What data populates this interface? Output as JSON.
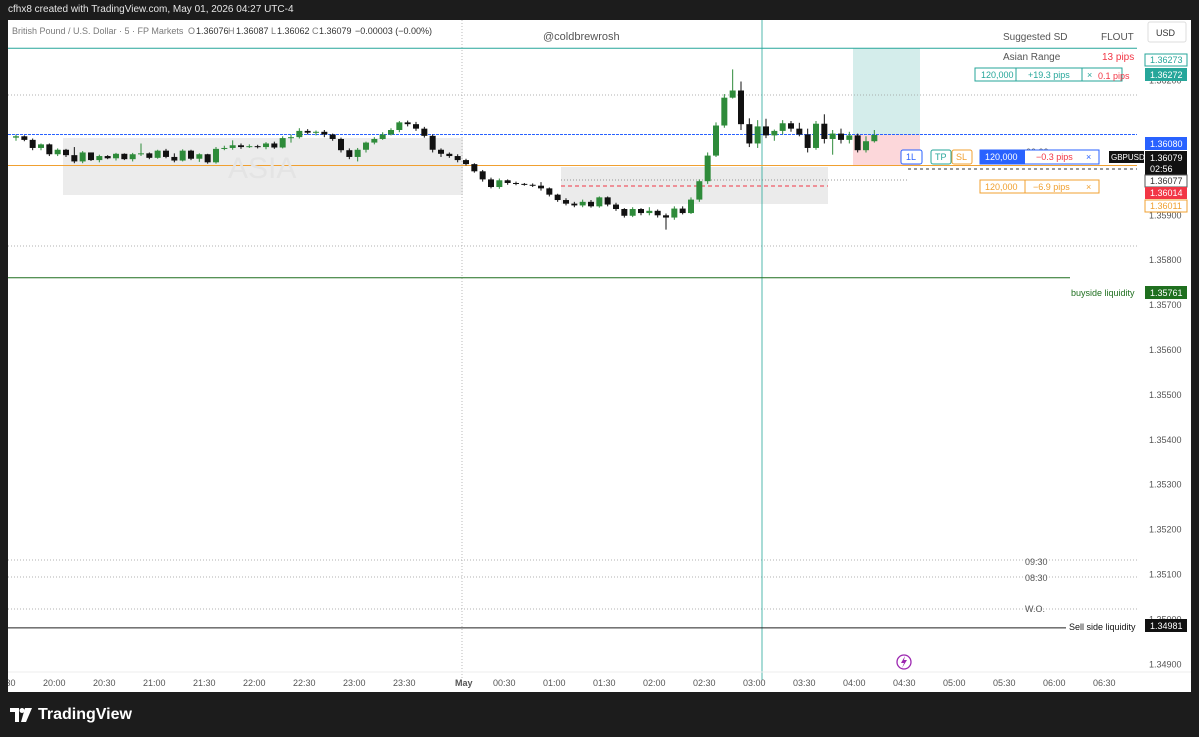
{
  "header": {
    "text": "cfhx8 created with TradingView.com, May 01, 2026 04:27 UTC-4"
  },
  "legend": {
    "symbol": "British Pound / U.S. Dollar · 5 · FP Markets",
    "o_label": "O",
    "o": "1.36076",
    "h_label": "H",
    "h": "1.36087",
    "l_label": "L",
    "l": "1.36062",
    "c_label": "C",
    "c": "1.36079",
    "change": "−0.00003 (−0.00%)"
  },
  "watermark": "@coldbrewrosh",
  "info_table": {
    "row1_label": "Suggested SD",
    "row1_value": "FLOUT",
    "row2_label": "Asian Range",
    "row2_value": "13 pips"
  },
  "currency": "USD",
  "asia_label": "ASIA",
  "symbol_tag": "GBPUSD",
  "countdown": "02:56",
  "colors": {
    "bull": "#2e8b3a",
    "bear": "#111111",
    "teal": "#26a69a",
    "blue": "#2962ff",
    "orange": "#f0a030",
    "red": "#f23645",
    "dark_green": "#1f6f1f"
  },
  "orders": {
    "tp": {
      "qty": "120,000",
      "pips": "+19.3 pips",
      "close": "×",
      "right_text": "0.1 pips"
    },
    "entry": {
      "qty": "120,000",
      "pips": "−0.3 pips",
      "close": "×"
    },
    "sl": {
      "qty": "120,000",
      "pips": "−6.9 pips",
      "close": "×"
    },
    "btn_direction": "1L",
    "btn_tp": "TP",
    "btn_sl": "SL"
  },
  "levels": {
    "buyside": "buyside liquidity",
    "sellside": "Sell side liquidity",
    "t0930": "09:30",
    "t0830": "08:30",
    "t0000": "00:00",
    "wo": "W.O."
  },
  "price_tags": {
    "p1": "1.36273",
    "p2": "1.36272",
    "p3": "1.36080",
    "p4": "1.36079",
    "p5": "1.36077",
    "p6": "1.36014",
    "p7": "1.36011",
    "p8": "1.35761",
    "p9": "1.34981"
  },
  "brand": "TradingView",
  "chart_data": {
    "type": "candlestick",
    "y_ticks": [
      "1.36200",
      "1.35900",
      "1.35800",
      "1.35700",
      "1.35600",
      "1.35500",
      "1.35400",
      "1.35300",
      "1.35200",
      "1.35100",
      "1.35000",
      "1.34900"
    ],
    "y_tick_values": [
      1.362,
      1.359,
      1.358,
      1.357,
      1.356,
      1.355,
      1.354,
      1.353,
      1.352,
      1.351,
      1.35,
      1.349
    ],
    "x_ticks": [
      "19:30",
      "20:00",
      "20:30",
      "21:00",
      "21:30",
      "22:00",
      "22:30",
      "23:00",
      "23:30",
      "May",
      "00:30",
      "01:00",
      "01:30",
      "02:00",
      "02:30",
      "03:00",
      "03:30",
      "04:00",
      "04:30",
      "05:00",
      "05:30",
      "06:00",
      "06:30"
    ],
    "ylim": [
      1.34865,
      1.36335
    ],
    "levels": {
      "tp": 1.36272,
      "entry": 1.3608,
      "sl": 1.36011,
      "buyside": 1.35761,
      "sellside": 1.34981
    },
    "candles": [
      [
        1.36073,
        1.3608,
        1.36066,
        1.36076
      ],
      [
        1.36076,
        1.36078,
        1.36065,
        1.36068
      ],
      [
        1.36068,
        1.36071,
        1.36045,
        1.3605
      ],
      [
        1.3605,
        1.3606,
        1.36045,
        1.36058
      ],
      [
        1.36058,
        1.3606,
        1.36032,
        1.36036
      ],
      [
        1.36036,
        1.36049,
        1.36032,
        1.36046
      ],
      [
        1.36046,
        1.36048,
        1.3603,
        1.36034
      ],
      [
        1.36034,
        1.36052,
        1.36016,
        1.3602
      ],
      [
        1.3602,
        1.36043,
        1.36016,
        1.3604
      ],
      [
        1.3604,
        1.3604,
        1.36021,
        1.36023
      ],
      [
        1.36023,
        1.36035,
        1.36018,
        1.36032
      ],
      [
        1.36032,
        1.36034,
        1.36025,
        1.36027
      ],
      [
        1.36027,
        1.36039,
        1.36022,
        1.36037
      ],
      [
        1.36037,
        1.36038,
        1.36023,
        1.36025
      ],
      [
        1.36025,
        1.36039,
        1.3602,
        1.36036
      ],
      [
        1.36036,
        1.3606,
        1.36032,
        1.36038
      ],
      [
        1.36038,
        1.3604,
        1.36025,
        1.36028
      ],
      [
        1.36028,
        1.36046,
        1.36026,
        1.36044
      ],
      [
        1.36044,
        1.36048,
        1.36027,
        1.3603
      ],
      [
        1.3603,
        1.36038,
        1.36018,
        1.36022
      ],
      [
        1.36022,
        1.36047,
        1.3602,
        1.36044
      ],
      [
        1.36044,
        1.36046,
        1.36023,
        1.36026
      ],
      [
        1.36026,
        1.36038,
        1.36019,
        1.36036
      ],
      [
        1.36036,
        1.36037,
        1.36015,
        1.36018
      ],
      [
        1.36018,
        1.36052,
        1.36015,
        1.36048
      ],
      [
        1.36048,
        1.36055,
        1.36045,
        1.3605
      ],
      [
        1.3605,
        1.36067,
        1.36046,
        1.36056
      ],
      [
        1.36056,
        1.3606,
        1.36048,
        1.36052
      ],
      [
        1.36052,
        1.36058,
        1.3605,
        1.36054
      ],
      [
        1.36054,
        1.36057,
        1.36049,
        1.36052
      ],
      [
        1.36052,
        1.36063,
        1.36047,
        1.3606
      ],
      [
        1.3606,
        1.36064,
        1.36048,
        1.36051
      ],
      [
        1.36051,
        1.36076,
        1.36049,
        1.36072
      ],
      [
        1.36072,
        1.3608,
        1.36062,
        1.36074
      ],
      [
        1.36074,
        1.36094,
        1.36071,
        1.36088
      ],
      [
        1.36088,
        1.36092,
        1.3608,
        1.36084
      ],
      [
        1.36084,
        1.36089,
        1.36078,
        1.36086
      ],
      [
        1.36086,
        1.3609,
        1.36074,
        1.3608
      ],
      [
        1.3608,
        1.36082,
        1.36066,
        1.3607
      ],
      [
        1.3607,
        1.36073,
        1.3604,
        1.36045
      ],
      [
        1.36045,
        1.36049,
        1.36025,
        1.3603
      ],
      [
        1.3603,
        1.3605,
        1.3602,
        1.36046
      ],
      [
        1.36046,
        1.36064,
        1.3604,
        1.36062
      ],
      [
        1.36062,
        1.36074,
        1.36058,
        1.3607
      ],
      [
        1.3607,
        1.36085,
        1.36068,
        1.3608
      ],
      [
        1.3608,
        1.36094,
        1.36078,
        1.3609
      ],
      [
        1.3609,
        1.3611,
        1.36085,
        1.36107
      ],
      [
        1.36107,
        1.36111,
        1.36098,
        1.36103
      ],
      [
        1.36103,
        1.36108,
        1.36088,
        1.36093
      ],
      [
        1.36093,
        1.36097,
        1.36073,
        1.36077
      ],
      [
        1.36077,
        1.3608,
        1.3604,
        1.36046
      ],
      [
        1.36046,
        1.36049,
        1.3603,
        1.36037
      ],
      [
        1.36037,
        1.3604,
        1.36028,
        1.36032
      ],
      [
        1.36032,
        1.36036,
        1.36018,
        1.36023
      ],
      [
        1.36023,
        1.36026,
        1.36011,
        1.36014
      ],
      [
        1.36014,
        1.36016,
        1.35995,
        1.35998
      ],
      [
        1.35998,
        1.36001,
        1.35975,
        1.3598
      ],
      [
        1.3598,
        1.35984,
        1.3596,
        1.35963
      ],
      [
        1.35963,
        1.35982,
        1.35959,
        1.35978
      ],
      [
        1.35978,
        1.3598,
        1.35968,
        1.35972
      ],
      [
        1.35972,
        1.35975,
        1.35967,
        1.3597
      ],
      [
        1.3597,
        1.35972,
        1.35966,
        1.35968
      ],
      [
        1.35968,
        1.35971,
        1.35963,
        1.35966
      ],
      [
        1.35966,
        1.35974,
        1.35955,
        1.3596
      ],
      [
        1.3596,
        1.35962,
        1.35942,
        1.35946
      ],
      [
        1.35946,
        1.35948,
        1.3593,
        1.35934
      ],
      [
        1.35934,
        1.35938,
        1.35922,
        1.35926
      ],
      [
        1.35926,
        1.3593,
        1.35918,
        1.35922
      ],
      [
        1.35922,
        1.35935,
        1.35918,
        1.3593
      ],
      [
        1.3593,
        1.35934,
        1.35917,
        1.3592
      ],
      [
        1.3592,
        1.35942,
        1.35917,
        1.3594
      ],
      [
        1.3594,
        1.35942,
        1.3592,
        1.35924
      ],
      [
        1.35924,
        1.35928,
        1.3591,
        1.35914
      ],
      [
        1.35914,
        1.35916,
        1.35895,
        1.35899
      ],
      [
        1.35899,
        1.35918,
        1.35896,
        1.35914
      ],
      [
        1.35914,
        1.35916,
        1.359,
        1.35905
      ],
      [
        1.35905,
        1.35918,
        1.359,
        1.3591
      ],
      [
        1.3591,
        1.35913,
        1.35895,
        1.359
      ],
      [
        1.359,
        1.35904,
        1.35868,
        1.35895
      ],
      [
        1.35895,
        1.3592,
        1.3589,
        1.35915
      ],
      [
        1.35915,
        1.3592,
        1.35902,
        1.35905
      ],
      [
        1.35905,
        1.3594,
        1.35903,
        1.35935
      ],
      [
        1.35935,
        1.3598,
        1.3593,
        1.35976
      ],
      [
        1.35976,
        1.3604,
        1.3597,
        1.36033
      ],
      [
        1.36033,
        1.36107,
        1.3603,
        1.361
      ],
      [
        1.361,
        1.3617,
        1.36095,
        1.36162
      ],
      [
        1.36162,
        1.36225,
        1.3616,
        1.36178
      ],
      [
        1.36178,
        1.36198,
        1.3609,
        1.36103
      ],
      [
        1.36103,
        1.36116,
        1.36052,
        1.3606
      ],
      [
        1.3606,
        1.36112,
        1.3605,
        1.36098
      ],
      [
        1.36098,
        1.36115,
        1.36072,
        1.36078
      ],
      [
        1.36078,
        1.36091,
        1.36066,
        1.36088
      ],
      [
        1.36088,
        1.36112,
        1.3608,
        1.36105
      ],
      [
        1.36105,
        1.3611,
        1.36086,
        1.36093
      ],
      [
        1.36093,
        1.36106,
        1.36076,
        1.3608
      ],
      [
        1.3608,
        1.36093,
        1.3604,
        1.3605
      ],
      [
        1.3605,
        1.3611,
        1.36046,
        1.36104
      ],
      [
        1.36104,
        1.36125,
        1.3606,
        1.3607
      ],
      [
        1.3607,
        1.3609,
        1.36035,
        1.36082
      ],
      [
        1.36082,
        1.36093,
        1.3606,
        1.36068
      ],
      [
        1.36068,
        1.36086,
        1.3606,
        1.36078
      ],
      [
        1.36078,
        1.36082,
        1.3604,
        1.36045
      ],
      [
        1.36045,
        1.36076,
        1.3604,
        1.36065
      ],
      [
        1.36065,
        1.3609,
        1.36062,
        1.36079
      ]
    ]
  }
}
